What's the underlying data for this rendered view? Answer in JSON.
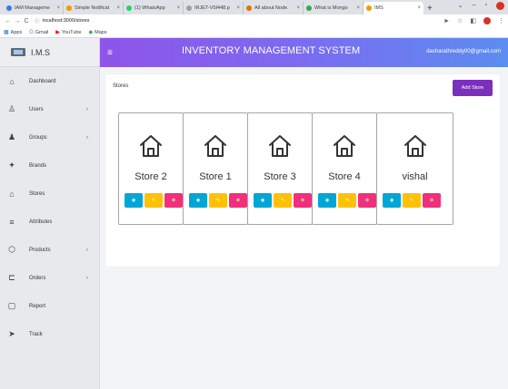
{
  "browser": {
    "tabs": [
      {
        "title": "IAM Manageme",
        "favicon_color": "#3b78e7",
        "active": false
      },
      {
        "title": "Simple Notificat",
        "favicon_color": "#f29900",
        "active": false
      },
      {
        "title": "(1) WhatsApp",
        "favicon_color": "#25d366",
        "active": false
      },
      {
        "title": "IRJET-V5I448.p",
        "favicon_color": "#9aa0a6",
        "active": false
      },
      {
        "title": "All about Node.",
        "favicon_color": "#e37400",
        "active": false
      },
      {
        "title": "What is Mongo",
        "favicon_color": "#34a853",
        "active": false
      },
      {
        "title": "IMS",
        "favicon_color": "#f29900",
        "active": true
      }
    ],
    "url": "localhost:3000/stores",
    "bookmarks": [
      {
        "label": "Apps",
        "icon": "apps-grid-icon"
      },
      {
        "label": "Gmail",
        "icon": "google-g-icon"
      },
      {
        "label": "YouTube",
        "icon": "youtube-icon"
      },
      {
        "label": "Maps",
        "icon": "maps-pin-icon"
      }
    ]
  },
  "app": {
    "brand": "I.M.S",
    "header_title": "INVENTORY MANAGEMENT SYSTEM",
    "user_email": "dasharathreddy00@gmail.com",
    "sidebar": [
      {
        "label": "Dashboard",
        "icon": "dashboard-icon",
        "glyph": "⌂",
        "chevron": false
      },
      {
        "label": "Users",
        "icon": "user-icon",
        "glyph": "♙",
        "chevron": true
      },
      {
        "label": "Groups",
        "icon": "groups-icon",
        "glyph": "♟",
        "chevron": true
      },
      {
        "label": "Brands",
        "icon": "brands-icon",
        "glyph": "✦",
        "chevron": false
      },
      {
        "label": "Stores",
        "icon": "store-icon",
        "glyph": "⌂",
        "chevron": false
      },
      {
        "label": "Attributes",
        "icon": "attributes-icon",
        "glyph": "≡",
        "chevron": false
      },
      {
        "label": "Products",
        "icon": "products-icon",
        "glyph": "⬡",
        "chevron": true
      },
      {
        "label": "Orders",
        "icon": "orders-icon",
        "glyph": "⊏",
        "chevron": true
      },
      {
        "label": "Report",
        "icon": "report-icon",
        "glyph": "▢",
        "chevron": false
      },
      {
        "label": "Track",
        "icon": "track-icon",
        "glyph": "➤",
        "chevron": false
      }
    ],
    "page_title": "Stores",
    "add_store_label": "Add Store",
    "stores": [
      {
        "name": "Store 2"
      },
      {
        "name": "Store 1"
      },
      {
        "name": "Store 3"
      },
      {
        "name": "Store 4"
      },
      {
        "name": "vishal"
      }
    ],
    "action_glyphs": {
      "view": "◉",
      "edit": "✎",
      "delete": "⊗"
    },
    "colors": {
      "accent": "#7b2fbf",
      "view": "#00a6d6",
      "edit": "#ffc107",
      "delete": "#f0307a"
    }
  }
}
